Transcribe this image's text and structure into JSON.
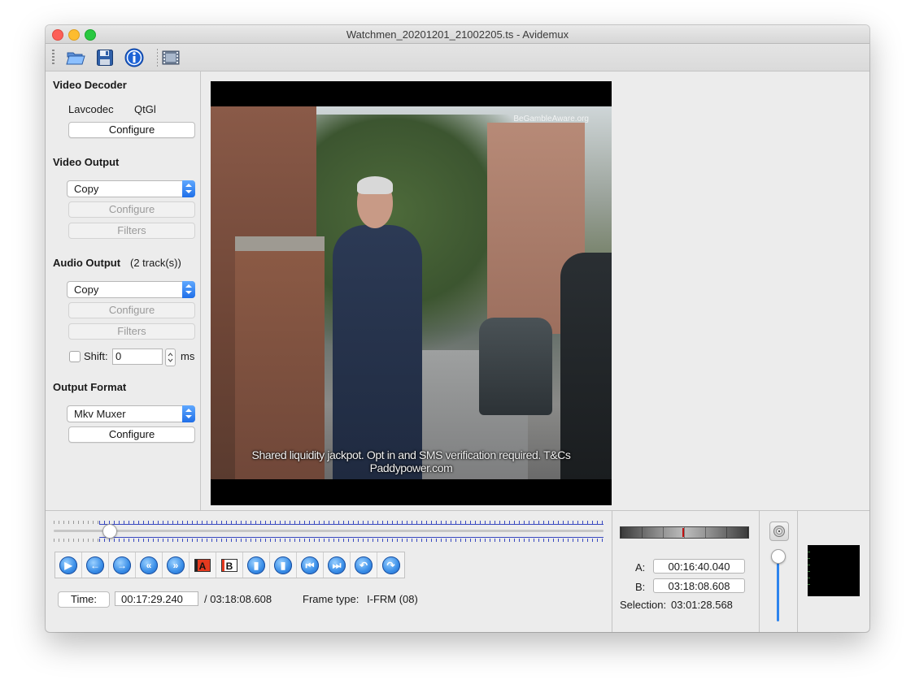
{
  "window": {
    "title": "Watchmen_20201201_21002205.ts - Avidemux"
  },
  "toolbar": {
    "buttons": [
      {
        "name": "open-video",
        "icon": "folder-open-icon"
      },
      {
        "name": "save-video",
        "icon": "floppy-disk-icon"
      },
      {
        "name": "properties",
        "icon": "info-icon"
      },
      {
        "name": "preview-output",
        "icon": "film-strip-icon"
      }
    ]
  },
  "left": {
    "video_decoder": {
      "title": "Video Decoder",
      "decoder_name": "Lavcodec",
      "decoder_mode": "QtGl",
      "configure": "Configure"
    },
    "video_output": {
      "title": "Video Output",
      "selected": "Copy",
      "configure": "Configure",
      "filters": "Filters"
    },
    "audio_output": {
      "title": "Audio Output",
      "tracks": "(2 track(s))",
      "selected": "Copy",
      "configure": "Configure",
      "filters": "Filters",
      "shift_label": "Shift:",
      "shift_value": "0",
      "shift_unit": "ms",
      "shift_checked": false
    },
    "output_format": {
      "title": "Output Format",
      "selected": "Mkv Muxer",
      "configure": "Configure"
    }
  },
  "video": {
    "caption": "Shared liquidity jackpot. Opt in and SMS verification required. T&Cs Paddypower.com",
    "watermark": "BeGambleAware.org"
  },
  "timeline": {
    "position_fraction": 0.0915
  },
  "navigation": {
    "buttons": [
      {
        "name": "play-button",
        "icon": "play-icon"
      },
      {
        "name": "previous-frame-button",
        "icon": "arrow-left-icon"
      },
      {
        "name": "next-frame-button",
        "icon": "arrow-right-icon"
      },
      {
        "name": "previous-keyframe-button",
        "icon": "rewind-icon"
      },
      {
        "name": "next-keyframe-button",
        "icon": "fast-forward-icon"
      },
      {
        "name": "set-marker-a-button",
        "icon": "marker-a-icon",
        "label": "A"
      },
      {
        "name": "set-marker-b-button",
        "icon": "marker-b-icon",
        "label": "B"
      },
      {
        "name": "previous-black-frame-button",
        "icon": "prev-black-frame-icon"
      },
      {
        "name": "next-black-frame-button",
        "icon": "next-black-frame-icon"
      },
      {
        "name": "first-frame-button",
        "icon": "go-first-icon"
      },
      {
        "name": "last-frame-button",
        "icon": "go-last-icon"
      },
      {
        "name": "go-marker-a-button",
        "icon": "go-marker-a-icon"
      },
      {
        "name": "go-marker-b-button",
        "icon": "go-marker-b-icon"
      }
    ]
  },
  "status": {
    "time_label": "Time:",
    "current_time": "00:17:29.240",
    "total_time": "/ 03:18:08.608",
    "frame_type_label": "Frame type:",
    "frame_type_value": "I-FRM (08)"
  },
  "markers": {
    "a_label": "A:",
    "a_value": "00:16:40.040",
    "b_label": "B:",
    "b_value": "03:18:08.608",
    "selection_label": "Selection:",
    "selection_value": "03:01:28.568"
  },
  "volume": {
    "icon": "speaker-icon",
    "level_fraction": 0.85
  },
  "colors": {
    "accent": "#1f6fe8",
    "timeline_ticks": "#3848c0",
    "shuttle_marker": "#c01010"
  }
}
